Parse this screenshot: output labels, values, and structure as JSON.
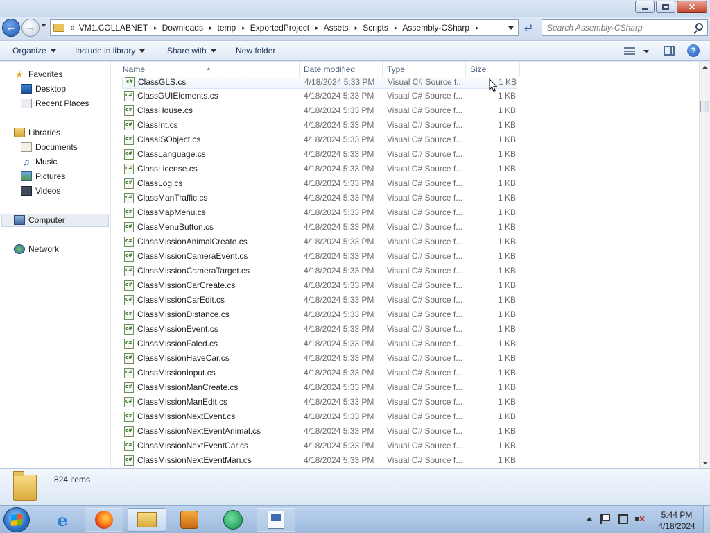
{
  "window": {
    "minimize_label": "",
    "maximize_label": "",
    "close_label": "✕"
  },
  "address": {
    "overflow": "«",
    "crumbs": [
      "VM1.COLLABNET",
      "Downloads",
      "temp",
      "ExportedProject",
      "Assets",
      "Scripts",
      "Assembly-CSharp"
    ]
  },
  "search": {
    "placeholder": "Search Assembly-CSharp"
  },
  "toolbar": {
    "organize": "Organize",
    "include": "Include in library",
    "share": "Share with",
    "new_folder": "New folder"
  },
  "navigation": {
    "favorites": "Favorites",
    "desktop": "Desktop",
    "recent": "Recent Places",
    "libraries": "Libraries",
    "documents": "Documents",
    "music": "Music",
    "pictures": "Pictures",
    "videos": "Videos",
    "computer": "Computer",
    "network": "Network"
  },
  "columns": {
    "name": "Name",
    "date": "Date modified",
    "type": "Type",
    "size": "Size"
  },
  "files": [
    {
      "name": "ClassGLS.cs",
      "date": "4/18/2024 5:33 PM",
      "type": "Visual C# Source f...",
      "size": "1 KB"
    },
    {
      "name": "ClassGUIElements.cs",
      "date": "4/18/2024 5:33 PM",
      "type": "Visual C# Source f...",
      "size": "1 KB"
    },
    {
      "name": "ClassHouse.cs",
      "date": "4/18/2024 5:33 PM",
      "type": "Visual C# Source f...",
      "size": "1 KB"
    },
    {
      "name": "ClassInt.cs",
      "date": "4/18/2024 5:33 PM",
      "type": "Visual C# Source f...",
      "size": "1 KB"
    },
    {
      "name": "ClassISObject.cs",
      "date": "4/18/2024 5:33 PM",
      "type": "Visual C# Source f...",
      "size": "1 KB"
    },
    {
      "name": "ClassLanguage.cs",
      "date": "4/18/2024 5:33 PM",
      "type": "Visual C# Source f...",
      "size": "1 KB"
    },
    {
      "name": "ClassLicense.cs",
      "date": "4/18/2024 5:33 PM",
      "type": "Visual C# Source f...",
      "size": "1 KB"
    },
    {
      "name": "ClassLog.cs",
      "date": "4/18/2024 5:33 PM",
      "type": "Visual C# Source f...",
      "size": "1 KB"
    },
    {
      "name": "ClassManTraffic.cs",
      "date": "4/18/2024 5:33 PM",
      "type": "Visual C# Source f...",
      "size": "1 KB"
    },
    {
      "name": "ClassMapMenu.cs",
      "date": "4/18/2024 5:33 PM",
      "type": "Visual C# Source f...",
      "size": "1 KB"
    },
    {
      "name": "ClassMenuButton.cs",
      "date": "4/18/2024 5:33 PM",
      "type": "Visual C# Source f...",
      "size": "1 KB"
    },
    {
      "name": "ClassMissionAnimalCreate.cs",
      "date": "4/18/2024 5:33 PM",
      "type": "Visual C# Source f...",
      "size": "1 KB"
    },
    {
      "name": "ClassMissionCameraEvent.cs",
      "date": "4/18/2024 5:33 PM",
      "type": "Visual C# Source f...",
      "size": "1 KB"
    },
    {
      "name": "ClassMissionCameraTarget.cs",
      "date": "4/18/2024 5:33 PM",
      "type": "Visual C# Source f...",
      "size": "1 KB"
    },
    {
      "name": "ClassMissionCarCreate.cs",
      "date": "4/18/2024 5:33 PM",
      "type": "Visual C# Source f...",
      "size": "1 KB"
    },
    {
      "name": "ClassMissionCarEdit.cs",
      "date": "4/18/2024 5:33 PM",
      "type": "Visual C# Source f...",
      "size": "1 KB"
    },
    {
      "name": "ClassMissionDistance.cs",
      "date": "4/18/2024 5:33 PM",
      "type": "Visual C# Source f...",
      "size": "1 KB"
    },
    {
      "name": "ClassMissionEvent.cs",
      "date": "4/18/2024 5:33 PM",
      "type": "Visual C# Source f...",
      "size": "1 KB"
    },
    {
      "name": "ClassMissionFaled.cs",
      "date": "4/18/2024 5:33 PM",
      "type": "Visual C# Source f...",
      "size": "1 KB"
    },
    {
      "name": "ClassMissionHaveCar.cs",
      "date": "4/18/2024 5:33 PM",
      "type": "Visual C# Source f...",
      "size": "1 KB"
    },
    {
      "name": "ClassMissionInput.cs",
      "date": "4/18/2024 5:33 PM",
      "type": "Visual C# Source f...",
      "size": "1 KB"
    },
    {
      "name": "ClassMissionManCreate.cs",
      "date": "4/18/2024 5:33 PM",
      "type": "Visual C# Source f...",
      "size": "1 KB"
    },
    {
      "name": "ClassMissionManEdit.cs",
      "date": "4/18/2024 5:33 PM",
      "type": "Visual C# Source f...",
      "size": "1 KB"
    },
    {
      "name": "ClassMissionNextEvent.cs",
      "date": "4/18/2024 5:33 PM",
      "type": "Visual C# Source f...",
      "size": "1 KB"
    },
    {
      "name": "ClassMissionNextEventAnimal.cs",
      "date": "4/18/2024 5:33 PM",
      "type": "Visual C# Source f...",
      "size": "1 KB"
    },
    {
      "name": "ClassMissionNextEventCar.cs",
      "date": "4/18/2024 5:33 PM",
      "type": "Visual C# Source f...",
      "size": "1 KB"
    },
    {
      "name": "ClassMissionNextEventMan.cs",
      "date": "4/18/2024 5:33 PM",
      "type": "Visual C# Source f...",
      "size": "1 KB"
    }
  ],
  "details": {
    "item_count": "824 items"
  },
  "clock": {
    "time": "5:44 PM",
    "date": "4/18/2024"
  }
}
